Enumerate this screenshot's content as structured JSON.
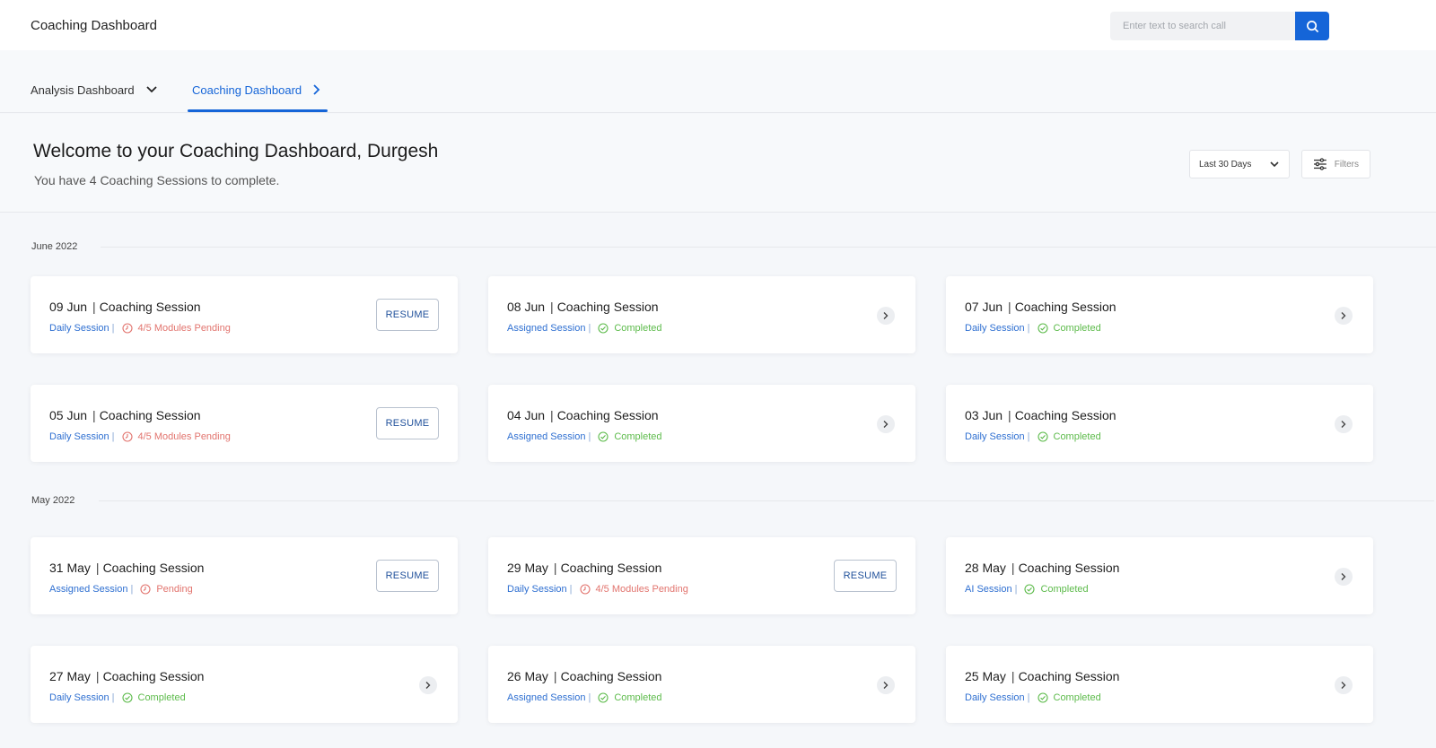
{
  "header": {
    "title": "Coaching Dashboard",
    "search_placeholder": "Enter text to search call"
  },
  "tabs": [
    {
      "label": "Analysis Dashboard",
      "active": false
    },
    {
      "label": "Coaching Dashboard",
      "active": true
    }
  ],
  "welcome": {
    "title": "Welcome to your Coaching Dashboard, Durgesh",
    "subtitle": "You have 4 Coaching Sessions to complete."
  },
  "controls": {
    "range": "Last 30 Days",
    "filters_label": "Filters"
  },
  "months": [
    {
      "label": "June 2022"
    },
    {
      "label": "May 2022"
    }
  ],
  "sessions": [
    {
      "date": "09 Jun",
      "title": "Coaching Session",
      "type": "Daily Session",
      "status": "4/5 Modules Pending",
      "state": "pending",
      "action": "RESUME"
    },
    {
      "date": "08 Jun",
      "title": "Coaching Session",
      "type": "Assigned Session",
      "status": "Completed",
      "state": "completed"
    },
    {
      "date": "07 Jun",
      "title": "Coaching Session",
      "type": "Daily Session",
      "status": "Completed",
      "state": "completed"
    },
    {
      "date": "05 Jun",
      "title": "Coaching Session",
      "type": "Daily Session",
      "status": "4/5 Modules Pending",
      "state": "pending",
      "action": "RESUME"
    },
    {
      "date": "04 Jun",
      "title": "Coaching Session",
      "type": "Assigned Session",
      "status": "Completed",
      "state": "completed"
    },
    {
      "date": "03 Jun",
      "title": "Coaching Session",
      "type": "Daily Session",
      "status": "Completed",
      "state": "completed"
    },
    {
      "date": "31 May",
      "title": "Coaching Session",
      "type": "Assigned Session",
      "status": "Pending",
      "state": "pending",
      "action": "RESUME"
    },
    {
      "date": "29 May",
      "title": "Coaching Session",
      "type": "Daily Session",
      "status": "4/5 Modules Pending",
      "state": "pending",
      "action": "RESUME"
    },
    {
      "date": "28 May",
      "title": "Coaching Session",
      "type": "AI Session",
      "status": "Completed",
      "state": "completed"
    },
    {
      "date": "27 May",
      "title": "Coaching Session",
      "type": "Daily Session",
      "status": "Completed",
      "state": "completed"
    },
    {
      "date": "26 May",
      "title": "Coaching Session",
      "type": "Assigned Session",
      "status": "Completed",
      "state": "completed"
    },
    {
      "date": "25 May",
      "title": "Coaching Session",
      "type": "Daily Session",
      "status": "Completed",
      "state": "completed"
    }
  ],
  "colors": {
    "accent": "#1565d8",
    "pending": "#e2746e",
    "completed": "#5dbb4b",
    "session_type": "#2e6fd1"
  }
}
